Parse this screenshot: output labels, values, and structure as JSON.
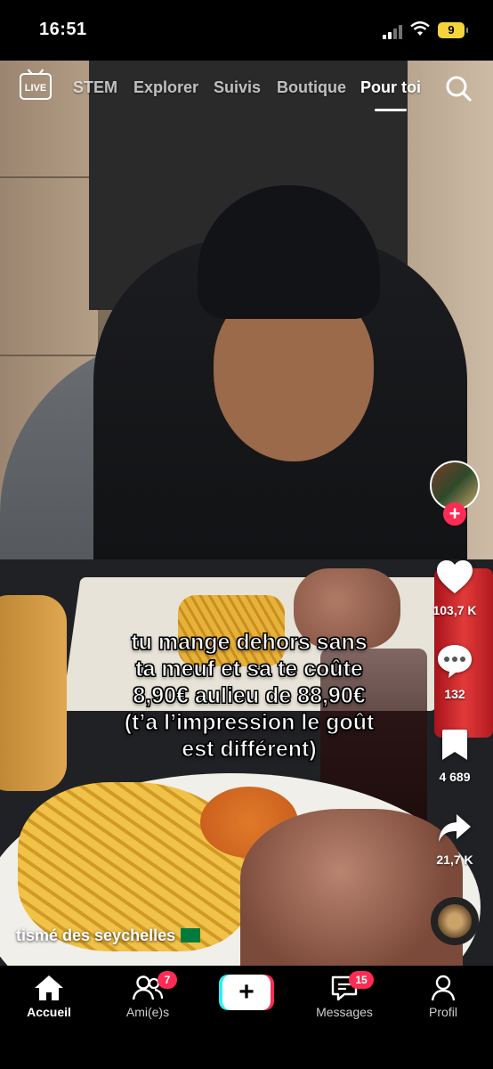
{
  "status_bar": {
    "time": "16:51",
    "battery": "9"
  },
  "top_tabs": {
    "live_label": "LIVE",
    "items": [
      "STEM",
      "Explorer",
      "Suivis",
      "Boutique",
      "Pour toi"
    ],
    "active": "Pour toi"
  },
  "actions": {
    "likes": "103,7 K",
    "comments": "132",
    "saves": "4 689",
    "shares": "21,7 K"
  },
  "caption": {
    "lines": [
      "tu mange dehors sans",
      "ta meuf et sa te coûte",
      "8,90€ aulieu de 88,90€",
      "(t’a l’impression le goût",
      "est différent)"
    ]
  },
  "sound": {
    "title": "tismé des seychelles"
  },
  "bottom_nav": {
    "home": "Accueil",
    "friends": "Ami(e)s",
    "friends_badge": "7",
    "create": "+",
    "messages": "Messages",
    "messages_badge": "15",
    "profile": "Profil"
  },
  "colors": {
    "accent": "#fe2c55",
    "cyan": "#25f4ee"
  }
}
